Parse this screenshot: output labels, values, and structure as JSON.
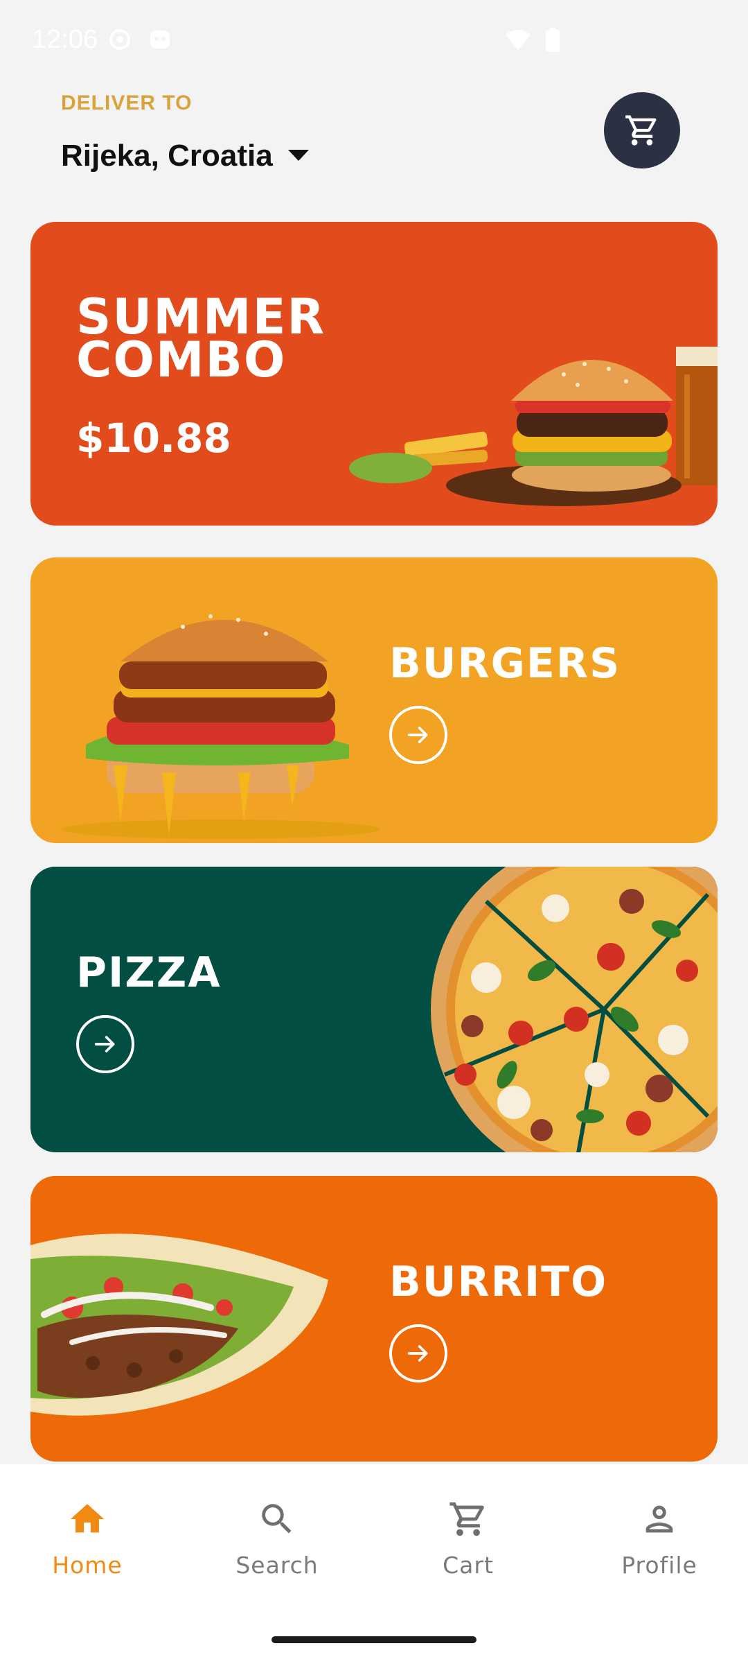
{
  "status_bar": {
    "time": "12:06"
  },
  "header": {
    "deliver_label": "DELIVER TO",
    "location": "Rijeka, Croatia"
  },
  "promo": {
    "title": "SUMMER COMBO",
    "price": "$10.88",
    "bg_color": "#e24b1c"
  },
  "categories": [
    {
      "label": "BURGERS",
      "bg_color": "#f3a323"
    },
    {
      "label": "PIZZA",
      "bg_color": "#034e42"
    },
    {
      "label": "BURRITO",
      "bg_color": "#ee6a08"
    }
  ],
  "bottom_nav": {
    "items": [
      {
        "label": "Home",
        "icon": "home-icon",
        "active": true
      },
      {
        "label": "Search",
        "icon": "search-icon",
        "active": false
      },
      {
        "label": "Cart",
        "icon": "cart-icon",
        "active": false
      },
      {
        "label": "Profile",
        "icon": "profile-icon",
        "active": false
      }
    ],
    "active_color": "#f08a12"
  }
}
